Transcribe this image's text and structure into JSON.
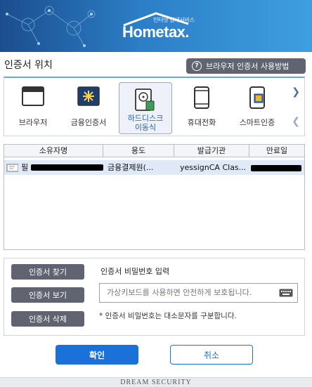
{
  "header": {
    "logo_sub": "인터넷 납세서비스",
    "logo_main": "Hometax."
  },
  "location": {
    "title": "인증서 위치",
    "guide_button": "브라우저 인증서 사용방법"
  },
  "storage": {
    "items": [
      {
        "label": "브라우저",
        "icon": "browser-icon"
      },
      {
        "label": "금융인증서",
        "icon": "financial-cert-icon"
      },
      {
        "label": "하드디스크\n이동식",
        "icon": "harddisk-icon",
        "selected": true
      },
      {
        "label": "휴대전화",
        "icon": "mobile-phone-icon"
      },
      {
        "label": "스마트인증",
        "icon": "smart-cert-icon"
      }
    ]
  },
  "table": {
    "headers": [
      "소유자명",
      "용도",
      "발급기관",
      "만료일"
    ],
    "rows": [
      {
        "owner": "필",
        "usage": "금융결제원(...",
        "issuer": "yessignCA Clas...",
        "expiry": ""
      }
    ]
  },
  "actions": {
    "find": "인증서 찾기",
    "view": "인증서 보기",
    "delete": "인증서 삭제",
    "pw_label": "인증서 비밀번호 입력",
    "pw_placeholder": "가상키보드를 사용하면 안전하게 보호됩니다.",
    "pw_note": "* 인증서 비밀번호는 대소문자를 구분합니다."
  },
  "buttons": {
    "ok": "확인",
    "cancel": "취소"
  },
  "footer": "DREAM SECURITY",
  "colors": {
    "primary": "#1a72d8",
    "dark_button": "#5f6470",
    "header_start": "#1b4e8f",
    "header_end": "#3e9fe0"
  }
}
